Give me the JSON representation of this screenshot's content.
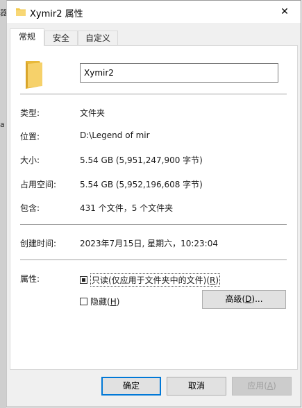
{
  "window": {
    "title": "Xymir2 属性",
    "close_glyph": "✕"
  },
  "background_fragments": [
    "器",
    "a"
  ],
  "tabs": [
    {
      "label": "常规",
      "active": true
    },
    {
      "label": "安全",
      "active": false
    },
    {
      "label": "自定义",
      "active": false
    }
  ],
  "general": {
    "name_value": "Xymir2",
    "type_label": "类型:",
    "type_value": "文件夹",
    "location_label": "位置:",
    "location_value": "D:\\Legend of mir",
    "size_label": "大小:",
    "size_value": "5.54 GB (5,951,247,900 字节)",
    "disk_size_label": "占用空间:",
    "disk_size_value": "5.54 GB (5,952,196,608 字节)",
    "contains_label": "包含:",
    "contains_value": "431 个文件，5 个文件夹",
    "created_label": "创建时间:",
    "created_value": "2023年7月15日, 星期六，10:23:04",
    "attributes_label": "属性:",
    "readonly_label": "只读(仅应用于文件夹中的文件)(",
    "readonly_key": "R",
    "hidden_label": "隐藏(",
    "hidden_key": "H",
    "advanced_button": "高级(",
    "advanced_key": "D",
    "advanced_suffix": ")..."
  },
  "footer": {
    "ok": "确定",
    "cancel": "取消",
    "apply": "应用(",
    "apply_key": "A"
  },
  "colors": {
    "folder": "#f2c94c",
    "accent": "#0078d7"
  }
}
